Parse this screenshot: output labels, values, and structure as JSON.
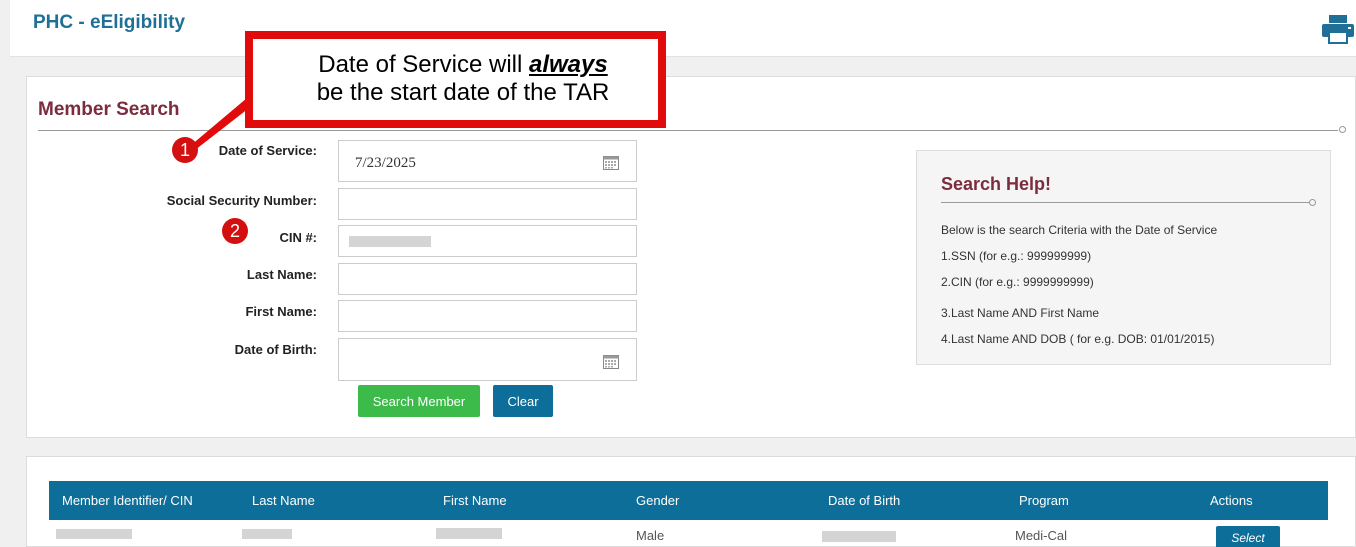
{
  "header": {
    "app_title": "PHC - eEligibility",
    "print_icon": "printer-icon"
  },
  "search": {
    "title": "Member Search",
    "fields": {
      "date_of_service": {
        "label": "Date of Service:",
        "value": "7/23/2025"
      },
      "ssn": {
        "label": "Social Security Number:",
        "value": ""
      },
      "cin": {
        "label": "CIN #:",
        "value": ""
      },
      "last_name": {
        "label": "Last Name:",
        "value": ""
      },
      "first_name": {
        "label": "First Name:",
        "value": ""
      },
      "dob": {
        "label": "Date of Birth:",
        "value": ""
      }
    },
    "calendar_icon": "calendar-icon",
    "search_button": "Search Member",
    "clear_button": "Clear"
  },
  "help": {
    "title": "Search Help!",
    "intro": "Below is the search Criteria with the Date of Service",
    "items": [
      "1.SSN (for e.g.: 999999999)",
      "2.CIN (for e.g.: 9999999999)",
      "3.Last Name AND First Name",
      "4.Last Name AND DOB ( for e.g. DOB: 01/01/2015)"
    ]
  },
  "callout": {
    "line1_prefix": "Date of Service will ",
    "line1_emphasis": "always",
    "line2": "be the start date of the TAR"
  },
  "badges": [
    "1",
    "2"
  ],
  "results": {
    "columns": [
      "Member Identifier/ CIN",
      "Last Name",
      "First Name",
      "Gender",
      "Date of Birth",
      "Program",
      "Actions"
    ],
    "rows": [
      {
        "gender": "Male",
        "program": "Medi-Cal",
        "action": "Select"
      }
    ]
  },
  "colors": {
    "brand_blue": "#0d6e99",
    "title_maroon": "#7b2c3f",
    "callout_red": "#e10b0b",
    "button_green": "#3dbb4a"
  }
}
